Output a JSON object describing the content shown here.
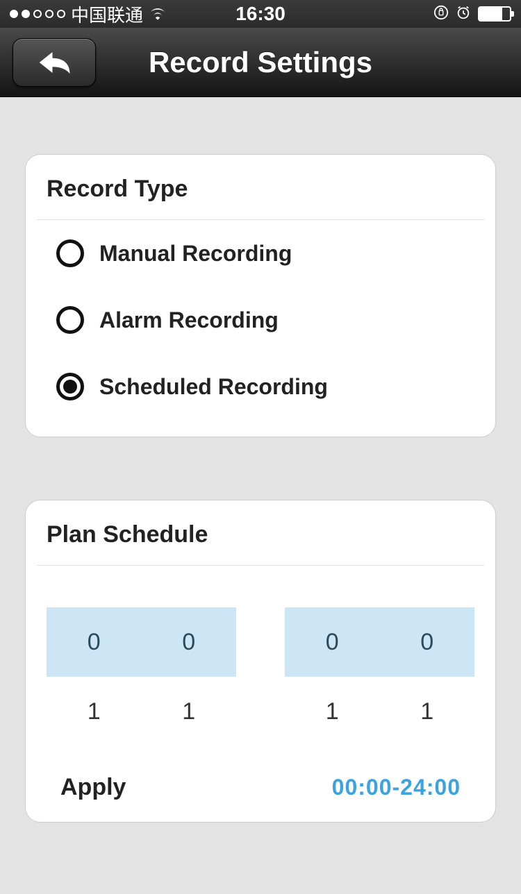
{
  "status": {
    "carrier": "中国联通",
    "time": "16:30"
  },
  "nav": {
    "title": "Record Settings"
  },
  "recordType": {
    "title": "Record Type",
    "options": [
      {
        "label": "Manual Recording",
        "selected": false
      },
      {
        "label": "Alarm Recording",
        "selected": false
      },
      {
        "label": "Scheduled Recording",
        "selected": true
      }
    ]
  },
  "planSchedule": {
    "title": "Plan Schedule",
    "startPicker": {
      "selectedRow": [
        "0",
        "0"
      ],
      "nextRow": [
        "1",
        "1"
      ]
    },
    "endPicker": {
      "selectedRow": [
        "0",
        "0"
      ],
      "nextRow": [
        "1",
        "1"
      ]
    },
    "applyLabel": "Apply",
    "applyRange": "00:00-24:00"
  }
}
